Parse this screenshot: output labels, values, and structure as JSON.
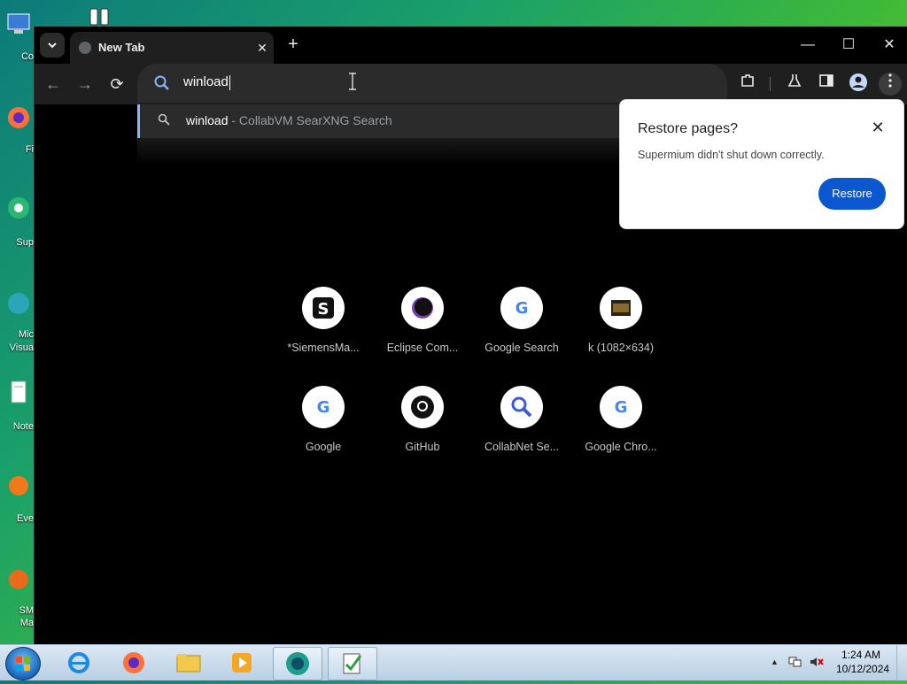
{
  "desktop": {
    "labels": [
      "Co",
      "Fi",
      "Sup",
      "Mic",
      "Visua",
      "Note",
      "Eve",
      "SM",
      "Ma"
    ]
  },
  "browser": {
    "tab": {
      "title": "New Tab",
      "close": "✕"
    },
    "new_tab": "+",
    "window": {
      "minimize": "—",
      "maximize": "☐",
      "close": "✕"
    },
    "nav": {
      "back": "←",
      "forward": "→",
      "reload": "⟳"
    },
    "omnibox": {
      "value": "winload"
    },
    "suggestion": {
      "query": "winload",
      "description": " - CollabVM SearXNG Search"
    },
    "toolbar_icons": [
      "extensions-icon",
      "labs-icon",
      "sidepanel-icon",
      "profile-icon",
      "menu-icon"
    ]
  },
  "restore_popup": {
    "title": "Restore pages?",
    "message": "Supermium didn't shut down correctly.",
    "close": "✕",
    "button": "Restore",
    "button_color": "#0b57d0"
  },
  "shortcuts": [
    {
      "label": "*SiemensMa...",
      "icon": "siemens-icon"
    },
    {
      "label": "Eclipse Com...",
      "icon": "eclipse-icon"
    },
    {
      "label": "Google Search",
      "icon": "google-icon"
    },
    {
      "label": "k (1082×634)",
      "icon": "image-thumb-icon"
    },
    {
      "label": "Google",
      "icon": "google-icon"
    },
    {
      "label": "GitHub",
      "icon": "github-icon"
    },
    {
      "label": "CollabNet Se...",
      "icon": "search-icon"
    },
    {
      "label": "Google Chro...",
      "icon": "google-icon"
    }
  ],
  "taskbar": {
    "clock": {
      "time": "1:24 AM",
      "date": "10/12/2024"
    },
    "tray_arrow": "▲"
  }
}
